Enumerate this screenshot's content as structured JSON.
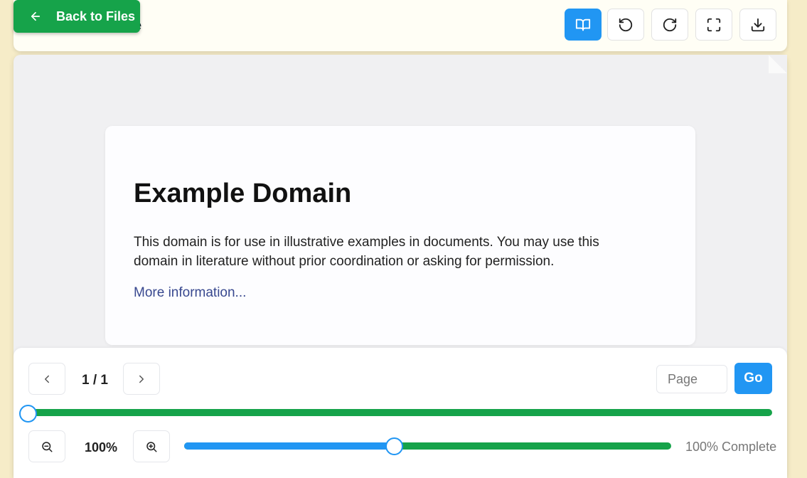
{
  "header": {
    "doc_title": "ilure",
    "back_label": "Back to Files",
    "toolbar": [
      {
        "name": "reading-mode-button",
        "icon": "book-open-icon",
        "active": true
      },
      {
        "name": "rotate-left-button",
        "icon": "rotate-ccw-icon",
        "active": false
      },
      {
        "name": "rotate-right-button",
        "icon": "rotate-cw-icon",
        "active": false
      },
      {
        "name": "fullscreen-button",
        "icon": "fullscreen-icon",
        "active": false
      },
      {
        "name": "download-button",
        "icon": "download-icon",
        "active": false
      }
    ]
  },
  "page": {
    "heading": "Example Domain",
    "body": "This domain is for use in illustrative examples in documents. You may use this domain in literature without prior coordination or asking for permission.",
    "link": "More information..."
  },
  "controls": {
    "page_indicator": "1 / 1",
    "page_input_placeholder": "Page",
    "go_label": "Go",
    "page_progress": 0.0,
    "zoom_level": "100%",
    "zoom_slider_fraction": 0.43,
    "complete_label": "100% Complete"
  },
  "colors": {
    "accent_blue": "#2196f3",
    "accent_green": "#16a34a",
    "link": "#38488f",
    "backdrop": "#f6ecc8"
  }
}
